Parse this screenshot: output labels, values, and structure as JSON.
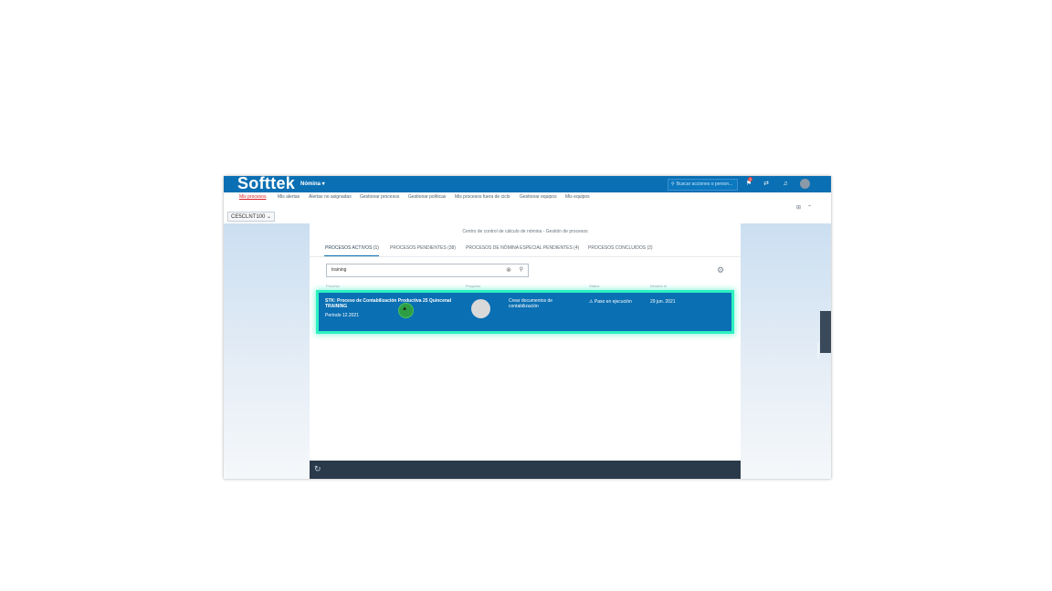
{
  "header": {
    "logo": "Softtek",
    "module": "Nómina",
    "search_placeholder": "Buscar acciones o person...",
    "notification_count": "3"
  },
  "nav": {
    "items": [
      "Mis procesos",
      "Mis alertas",
      "Alertas no asignadas",
      "Gestionar procesos",
      "Gestionar políticas",
      "Mis procesos fuera de ciclo",
      "Gestionar equipos",
      "Mis equipos"
    ]
  },
  "context": {
    "selector": "CE5CLNT100"
  },
  "page": {
    "title": "Centro de control de cálculo de nómina - Gestión de procesos",
    "tabs": [
      "PROCESOS ACTIVOS (1)",
      "PROCESOS PENDIENTES (38)",
      "PROCESOS DE NÓMINA ESPECIAL PENDIENTES (4)",
      "PROCESOS CONCLUIDOS (2)"
    ]
  },
  "search": {
    "value": "training"
  },
  "table": {
    "headers": [
      "Proceso",
      "Progreso",
      "Status",
      "Iniciado el"
    ],
    "rows": [
      {
        "process_title": "STK: Proceso de Contabilización Productiva 25 Quincenal TRAINING",
        "period": "Período 12.2021",
        "step": "Crear documentos de contabilización",
        "status": "Paso en ejecución",
        "date": "29 jun. 2021"
      }
    ]
  },
  "side_panel": {
    "label": "Asistencia"
  },
  "colors": {
    "brand": "#0a6fb3",
    "highlight": "#2cf0c0",
    "bottom_bar": "#2a3a4a"
  }
}
